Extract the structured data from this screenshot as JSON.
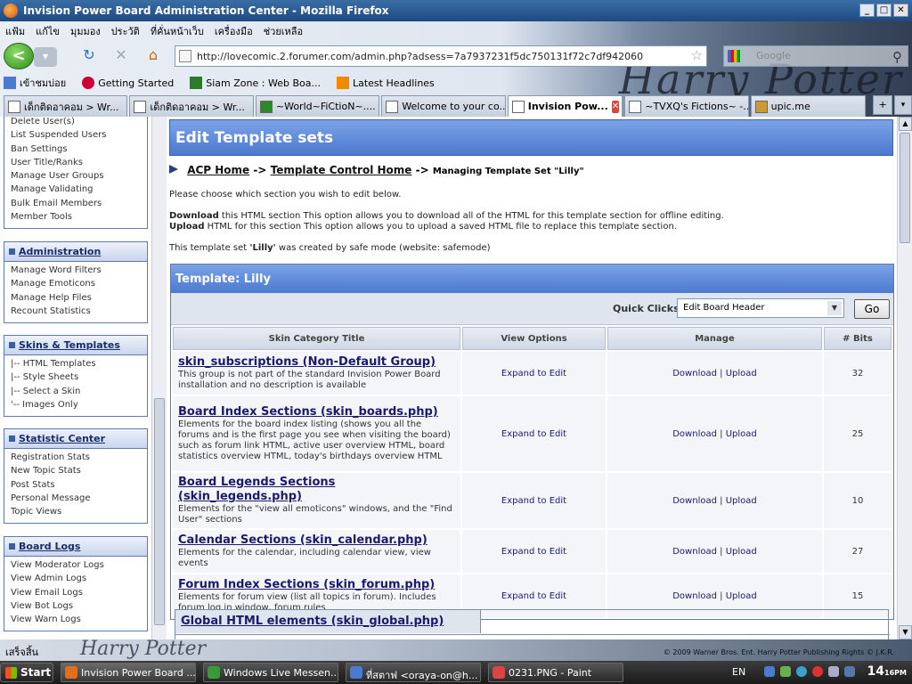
{
  "window": {
    "title": "Invision Power Board Administration Center - Mozilla Firefox",
    "btn_min": "_",
    "btn_max": "□",
    "btn_close": "✕"
  },
  "menu": [
    "แฟ้ม",
    "แก้ไข",
    "มุมมอง",
    "ประวัติ",
    "ที่คั่นหน้าเว็บ",
    "เครื่องมือ",
    "ช่วยเหลือ"
  ],
  "nav": {
    "url": "http://lovecomic.2.forumer.com/admin.php?adsess=7a7937231f5dc750131f72c7df942060",
    "search_placeholder": "Google",
    "back": "<",
    "forward": "▾",
    "reload": "↻",
    "stop": "✕",
    "home": "⌂",
    "star": "☆",
    "search_go": "⚲"
  },
  "bookmarks": [
    "เข้าชมบ่อย",
    "Getting Started",
    "Siam Zone : Web Boa...",
    "Latest Headlines"
  ],
  "tabs": [
    {
      "label": "เด็กติดอาคอม > Wr..."
    },
    {
      "label": "เด็กติดอาคอม > Wr..."
    },
    {
      "label": "~World~FiCtioN~...."
    },
    {
      "label": "Welcome to your co..."
    },
    {
      "label": "Invision Pow...",
      "active": true
    },
    {
      "label": "~TVXQ's Fictions~ -..."
    },
    {
      "label": "upic.me"
    }
  ],
  "tab_close": "✕",
  "tab_new": "+",
  "tab_list": "▾",
  "sidebar": {
    "top_items": [
      "Delete User(s)",
      "List Suspended Users",
      "Ban Settings",
      "User Title/Ranks",
      "Manage User Groups",
      "Manage Validating",
      "Bulk Email Members",
      "Member Tools"
    ],
    "sections": [
      {
        "title": "Administration",
        "items": [
          "Manage Word Filters",
          "Manage Emoticons",
          "Manage Help Files",
          "Recount Statistics"
        ]
      },
      {
        "title": "Skins & Templates",
        "items": [
          "|-- HTML Templates",
          "|-- Style Sheets",
          "|-- Select a Skin",
          "'-- Images Only"
        ]
      },
      {
        "title": "Statistic Center",
        "items": [
          "Registration Stats",
          "New Topic Stats",
          "Post Stats",
          "Personal Message",
          "Topic Views"
        ]
      },
      {
        "title": "Board Logs",
        "items": [
          "View Moderator Logs",
          "View Admin Logs",
          "View Email Logs",
          "View Bot Logs",
          "View Warn Logs"
        ]
      }
    ]
  },
  "main": {
    "title": "Edit Template sets",
    "crumb_home": "ACP Home",
    "crumb_sep": "->",
    "crumb_tpl": "Template Control Home",
    "crumb_tail": "Managing Template Set \"Lilly\"",
    "intro": "Please choose which section you wish to edit below.",
    "download_label": "Download",
    "download_text": "this HTML section This option allows you to download all of the HTML for this template section for offline editing.",
    "upload_label": "Upload",
    "upload_text": "HTML for this section This option allows you to upload a saved HTML file to replace this template section.",
    "created_pre": "This template set",
    "created_name": "'Lilly'",
    "created_mid": "was created by",
    "created_author": "safe mode",
    "created_web": "(website:",
    "created_site": "safemode",
    "created_end": ")",
    "template_title": "Template: Lilly",
    "quick_clicks_label": "Quick Clicks",
    "quick_clicks_value": "Edit Board Header",
    "go": "Go",
    "columns": [
      "Skin Category Title",
      "View Options",
      "Manage",
      "# Bits"
    ],
    "rows": [
      {
        "title": "skin_subscriptions (Non-Default Group)",
        "desc": "This group is not part of the standard Invision Power Board installation and no description is available",
        "view": "Expand to Edit",
        "download": "Download",
        "sep": "|",
        "upload": "Upload",
        "bits": "32"
      },
      {
        "title": "Board Index Sections (skin_boards.php)",
        "desc": "Elements for the board index listing (shows you all the forums and is the first page you see when visiting the board) such as forum link HTML, active user overview HTML, board statistics overview HTML, today's birthdays overview HTML",
        "view": "Expand to Edit",
        "download": "Download",
        "sep": "|",
        "upload": "Upload",
        "bits": "25"
      },
      {
        "title": "Board Legends Sections (skin_legends.php)",
        "desc": "Elements for the \"view all emoticons\" windows, and the \"Find User\" sections",
        "view": "Expand to Edit",
        "download": "Download",
        "sep": "|",
        "upload": "Upload",
        "bits": "10"
      },
      {
        "title": "Calendar Sections (skin_calendar.php)",
        "desc": "Elements for the calendar, including calendar view, view events",
        "view": "Expand to Edit",
        "download": "Download",
        "sep": "|",
        "upload": "Upload",
        "bits": "27"
      },
      {
        "title": "Forum Index Sections (skin_forum.php)",
        "desc": "Elements for forum view (list all topics in forum). Includes forum log in window, forum rules",
        "view": "Expand to Edit",
        "download": "Download",
        "sep": "|",
        "upload": "Upload",
        "bits": "15"
      }
    ],
    "global_title": "Global HTML elements (skin_global.php)"
  },
  "statusbar": {
    "text": "เสร็จสิ้น",
    "brand": "Harry Potter",
    "copyright": "© 2009 Warner Bros. Ent. Harry Potter Publishing Rights © J.K.R."
  },
  "banner_text": "Harry Potter",
  "taskbar": {
    "start": "Start",
    "tasks": [
      "Invision Power Board ...",
      "Windows Live Messen...",
      "ที่สตาฟ <oraya-on@h...",
      "0231.PNG - Paint"
    ],
    "lang": "EN",
    "time": "14",
    "time_min": "16",
    "ampm": "PM"
  },
  "colors": {
    "accent": "#4d79cf",
    "link": "#1a1a6e",
    "sidebar_border": "#5c7bb1"
  }
}
